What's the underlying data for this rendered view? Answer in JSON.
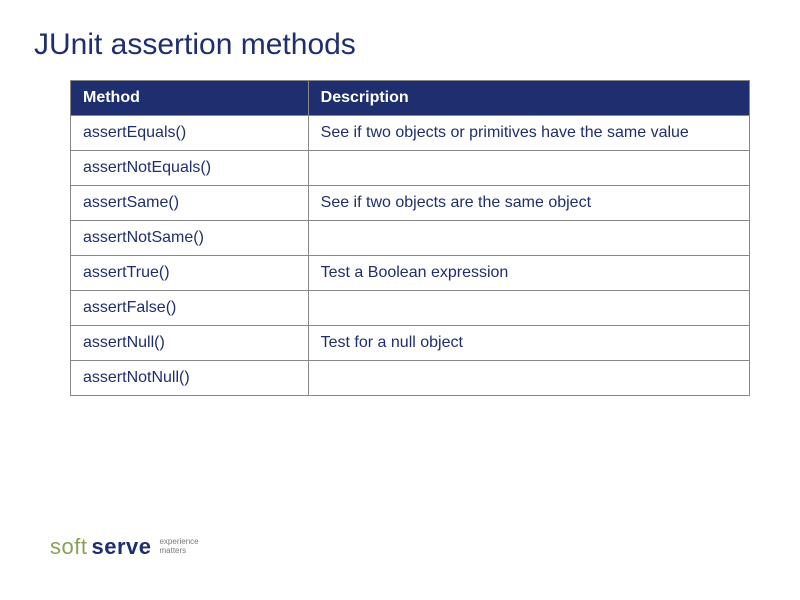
{
  "title": "JUnit assertion methods",
  "table": {
    "headers": {
      "method": "Method",
      "description": "Description"
    },
    "rows": [
      {
        "method": "assertEquals()",
        "description": "See if two objects or primitives have the same value"
      },
      {
        "method": "assertNotEquals()",
        "description": ""
      },
      {
        "method": "assertSame()",
        "description": "See if two objects are the same object"
      },
      {
        "method": "assertNotSame()",
        "description": ""
      },
      {
        "method": "assertTrue()",
        "description": "Test a Boolean expression"
      },
      {
        "method": "assertFalse()",
        "description": ""
      },
      {
        "method": "assertNull()",
        "description": "Test for a null object"
      },
      {
        "method": "assertNotNull()",
        "description": ""
      }
    ]
  },
  "footer": {
    "logo_part1": "soft",
    "logo_part2": "serve",
    "tagline_line1": "experience",
    "tagline_line2": "matters"
  }
}
